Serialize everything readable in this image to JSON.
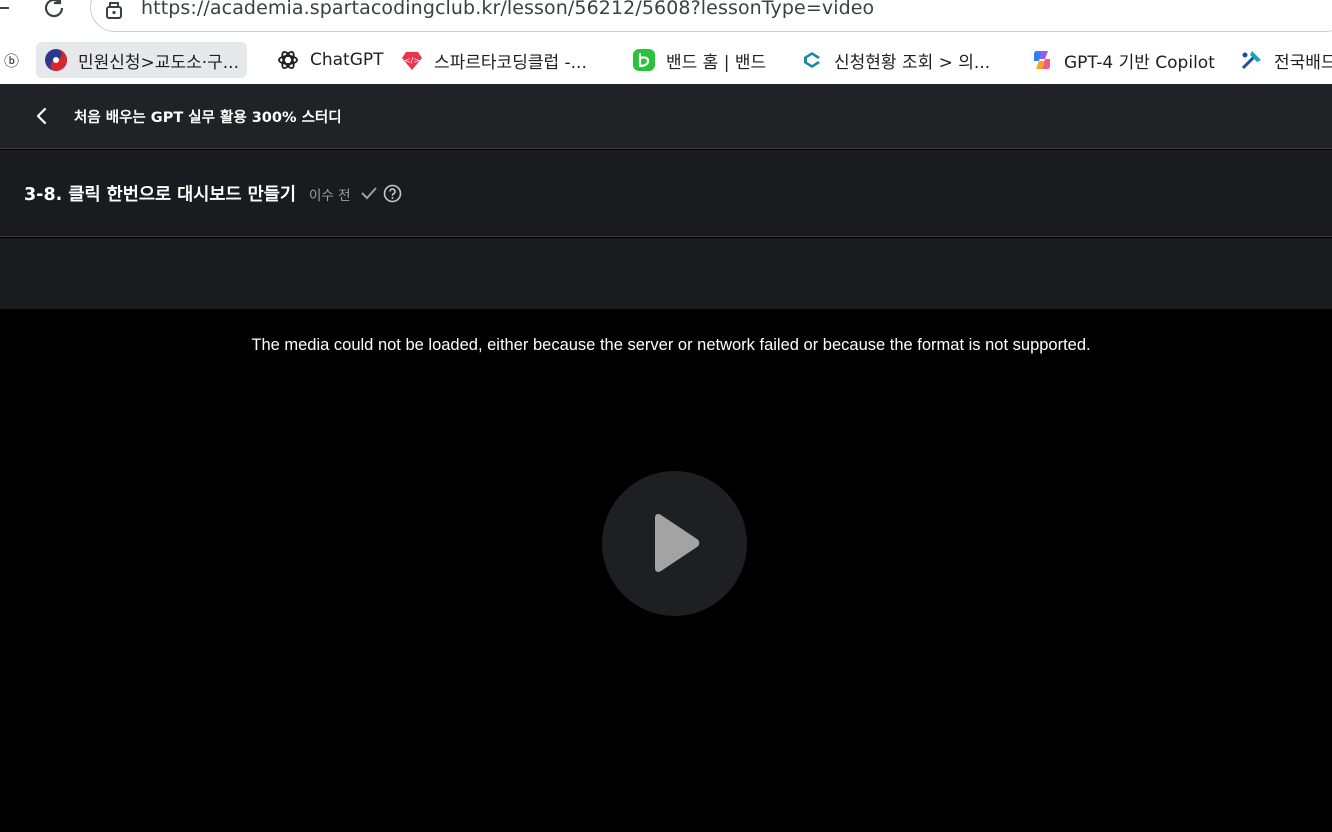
{
  "browser": {
    "url": "https://academia.spartacodingclub.kr/lesson/56212/5608?lessonType=video",
    "bookmarks": [
      {
        "label": "민원신청>교도소·구...",
        "icon": "gov-emblem-icon",
        "active": true
      },
      {
        "label": "ChatGPT",
        "icon": "openai-icon",
        "active": false
      },
      {
        "label": "스파르타코딩클럽 -...",
        "icon": "sparta-icon",
        "active": false
      },
      {
        "label": "밴드 홈 | 밴드",
        "icon": "band-icon",
        "active": false
      },
      {
        "label": "신청현황 조회 > 의...",
        "icon": "request-status-icon",
        "active": false
      },
      {
        "label": "GPT-4 기반 Copilot",
        "icon": "copilot-icon",
        "active": false
      },
      {
        "label": "전국배드",
        "icon": "badminton-icon",
        "active": false
      }
    ]
  },
  "course": {
    "title": "처음 배우는 GPT 실무 활용 300% 스터디"
  },
  "lesson": {
    "title": "3-8. 클릭 한번으로 대시보드 만들기",
    "status": "이수 전"
  },
  "video": {
    "error_message": "The media could not be loaded, either because the server or network failed or because the format is not supported."
  },
  "colors": {
    "header_bg": "#202226",
    "lesson_bg": "#1a1b1e",
    "video_bg": "#000000",
    "play_button_bg": "#1e1f21"
  }
}
